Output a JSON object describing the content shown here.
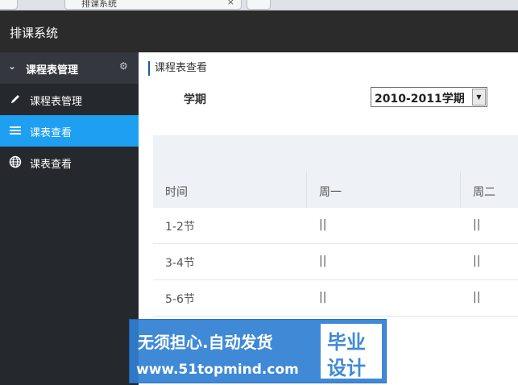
{
  "browser": {
    "tab_title": "排课系统",
    "tab_close": "×"
  },
  "app": {
    "title": "排课系统"
  },
  "sidebar": {
    "header": "课程表管理",
    "items": [
      {
        "label": "课程表管理",
        "icon": "pencil-icon",
        "active": false
      },
      {
        "label": "课表查看",
        "icon": "list-icon",
        "active": true
      },
      {
        "label": "课表查看",
        "icon": "globe-icon",
        "active": false
      }
    ]
  },
  "main": {
    "breadcrumb": "课程表查看",
    "term_label": "学期",
    "term_select": {
      "value": "2010-2011学期"
    },
    "table": {
      "headers": [
        "时间",
        "周一",
        "周二"
      ],
      "rows": [
        [
          "1-2节",
          "||",
          "||"
        ],
        [
          "3-4节",
          "||",
          "||"
        ],
        [
          "5-6节",
          "||",
          "||"
        ]
      ]
    }
  },
  "watermark": {
    "line1": "无须担心.自动发货",
    "line2": "www.51topmind.com",
    "box_top": "毕业",
    "box_bottom": "设计"
  },
  "colors": {
    "topbar": "#2b2b2b",
    "sidebar": "#25282c",
    "active": "#1e9ff2",
    "header_bg": "#eef1f5"
  }
}
